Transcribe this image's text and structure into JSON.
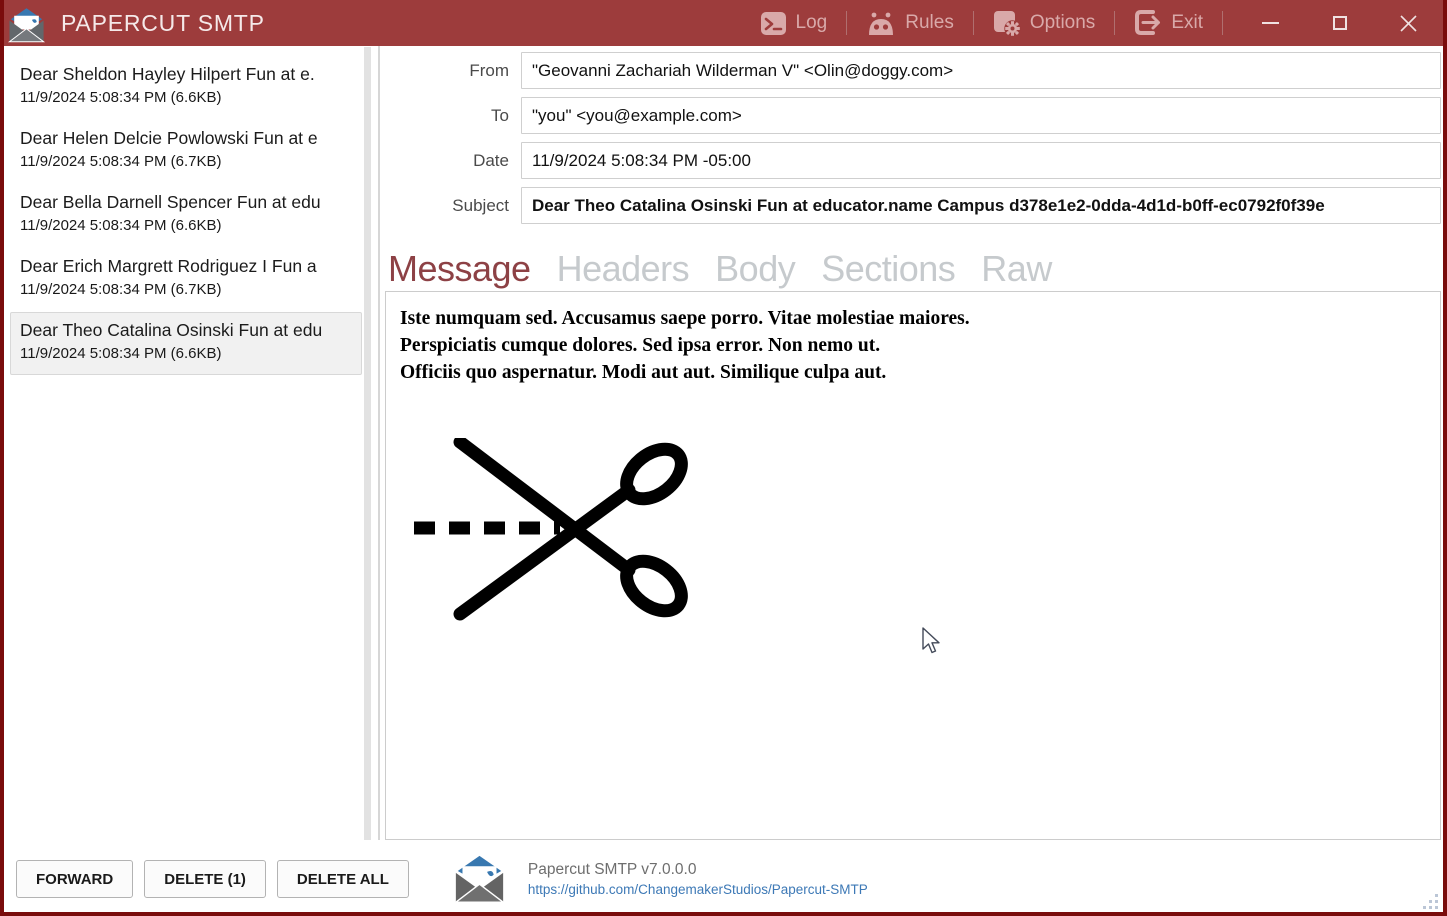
{
  "window": {
    "title": "PAPERCUT SMTP",
    "toolbar": {
      "log": "Log",
      "rules": "Rules",
      "options": "Options",
      "exit": "Exit"
    }
  },
  "email_list": {
    "selected_index": 4,
    "items": [
      {
        "subject": "Dear Sheldon Hayley Hilpert Fun at e.",
        "meta": "11/9/2024 5:08:34 PM (6.6KB)"
      },
      {
        "subject": "Dear Helen Delcie Powlowski Fun at e",
        "meta": "11/9/2024 5:08:34 PM (6.7KB)"
      },
      {
        "subject": "Dear Bella Darnell Spencer Fun at edu",
        "meta": "11/9/2024 5:08:34 PM (6.6KB)"
      },
      {
        "subject": "Dear Erich Margrett Rodriguez I Fun a",
        "meta": "11/9/2024 5:08:34 PM (6.7KB)"
      },
      {
        "subject": "Dear Theo Catalina Osinski Fun at edu",
        "meta": "11/9/2024 5:08:34 PM (6.6KB)"
      }
    ]
  },
  "detail": {
    "fields": {
      "from": {
        "label": "From",
        "value": "\"Geovanni Zachariah Wilderman V\" <Olin@doggy.com>"
      },
      "to": {
        "label": "To",
        "value": "\"you\" <you@example.com>"
      },
      "date": {
        "label": "Date",
        "value": "11/9/2024 5:08:34 PM -05:00"
      },
      "subject": {
        "label": "Subject",
        "value": "Dear Theo Catalina Osinski Fun at educator.name Campus d378e1e2-0dda-4d1d-b0ff-ec0792f0f39e"
      }
    },
    "tabs": [
      {
        "label": "Message",
        "active": true
      },
      {
        "label": "Headers",
        "active": false
      },
      {
        "label": "Body",
        "active": false
      },
      {
        "label": "Sections",
        "active": false
      },
      {
        "label": "Raw",
        "active": false
      }
    ],
    "message_lines": [
      "Iste numquam sed. Accusamus saepe porro. Vitae molestiae maiores.",
      "Perspiciatis cumque dolores. Sed ipsa error. Non nemo ut.",
      "Officiis quo aspernatur. Modi aut aut. Similique culpa aut."
    ],
    "image": "scissors-cut-graphic"
  },
  "actions": {
    "forward": "FORWARD",
    "delete": "DELETE (1)",
    "delete_all": "DELETE ALL"
  },
  "footer": {
    "version": "Papercut SMTP v7.0.0.0",
    "link": "https://github.com/ChangemakerStudios/Papercut-SMTP"
  },
  "colors": {
    "titlebar": "#9D3C3C",
    "window_border": "#7A0C0C",
    "accent_tab": "#8D4145",
    "link": "#3D79B6"
  }
}
